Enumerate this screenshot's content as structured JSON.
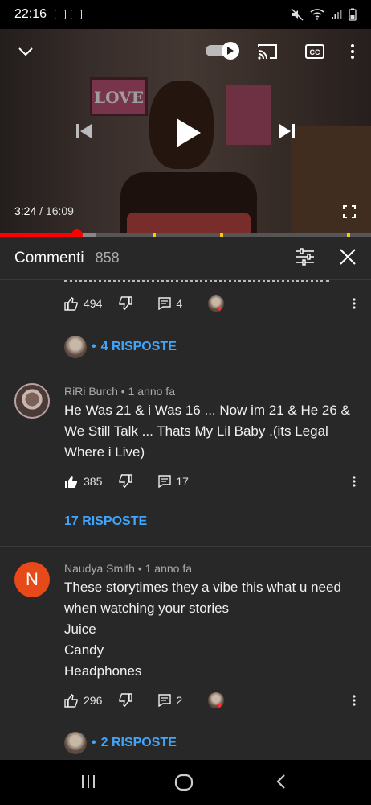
{
  "status_bar": {
    "time": "22:16"
  },
  "video": {
    "current_time": "3:24",
    "duration": "16:09",
    "poster_text": "LOVE",
    "progress_fraction": 0.21,
    "buffer_fraction": 0.26
  },
  "icons": {
    "collapse": "chevron-down-icon",
    "autoplay": "autoplay-toggle-icon",
    "cast": "cast-icon",
    "captions": "captions-icon",
    "more": "more-vertical-icon",
    "previous": "skip-previous-icon",
    "play": "play-icon",
    "next": "skip-next-icon",
    "fullscreen": "fullscreen-icon",
    "sort": "sort-icon",
    "close": "close-icon",
    "like": "thumb-up-icon",
    "dislike": "thumb-down-icon",
    "reply": "reply-icon"
  },
  "colors": {
    "accent_blue": "#3ea6ff",
    "progress_red": "#ff0000",
    "background": "#282828"
  },
  "comments_header": {
    "title": "Commenti",
    "count": "858"
  },
  "comments": [
    {
      "likes": "494",
      "replies": "4",
      "replies_link": "4 RISPOSTE",
      "creator_hearted": true
    },
    {
      "author": "RiRi Burch",
      "time": "1 anno fa",
      "text": "He Was 21 & i Was 16 ... Now im 21 & He 26 & We Still Talk ... Thats My Lil Baby .(its Legal Where i Live)",
      "likes": "385",
      "replies": "17",
      "replies_link": "17 RISPOSTE",
      "liked": true
    },
    {
      "author": "Naudya Smith",
      "avatar_letter": "N",
      "time": "1 anno fa",
      "text_lines": [
        "These storytimes they a vibe this what u need when watching your stories",
        "Juice",
        "Candy",
        "Headphones"
      ],
      "likes": "296",
      "replies": "2",
      "replies_link": "2 RISPOSTE",
      "creator_hearted": true
    }
  ]
}
